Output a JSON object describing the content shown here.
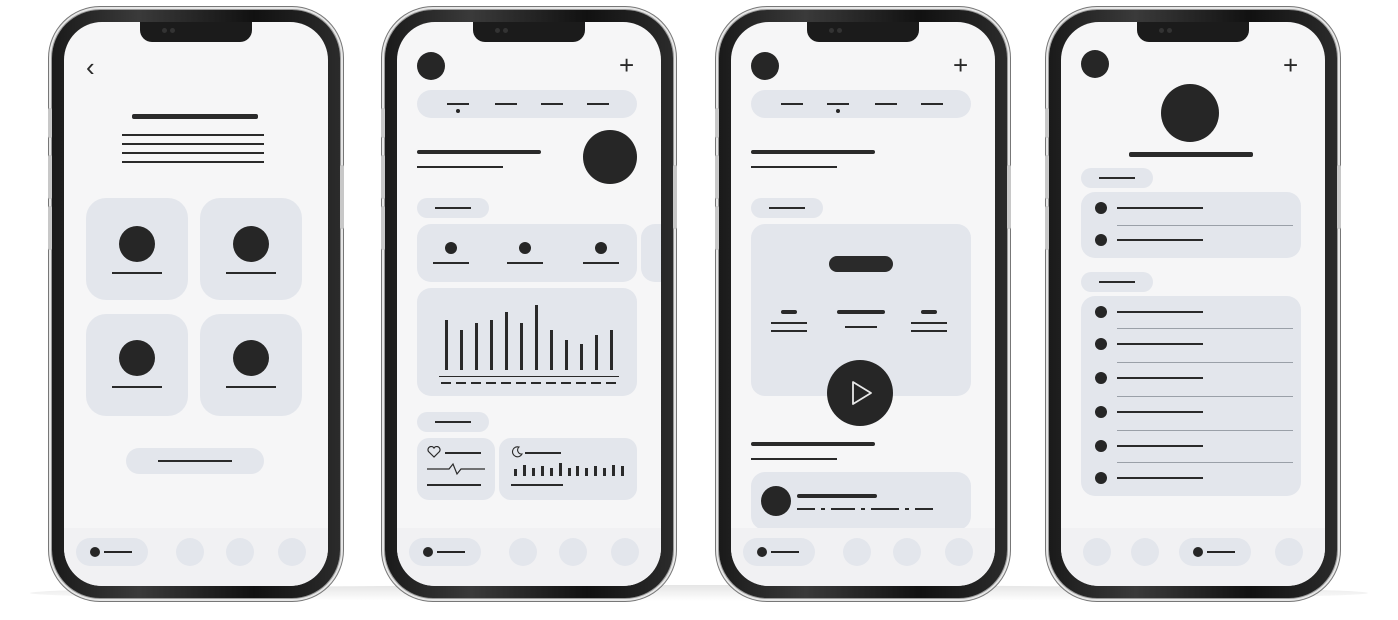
{
  "scene": "mobile-wireframe-set",
  "colors": {
    "accent": "#262626",
    "card": "#e3e6ec",
    "screen": "#f6f6f7"
  },
  "icons": {
    "back": "‹",
    "plus": "+",
    "play": "play-icon",
    "heart": "heart-icon",
    "moon": "moon-icon"
  },
  "screen2": {
    "activity_bars": [
      0.7,
      0.55,
      0.65,
      0.7,
      0.8,
      0.65,
      0.9,
      0.55,
      0.42,
      0.36,
      0.48,
      0.56
    ],
    "sleep_bars": [
      0.5,
      0.8,
      0.6,
      0.7,
      0.6,
      0.9,
      0.6,
      0.7,
      0.6,
      0.7,
      0.6,
      0.8,
      0.7
    ]
  }
}
